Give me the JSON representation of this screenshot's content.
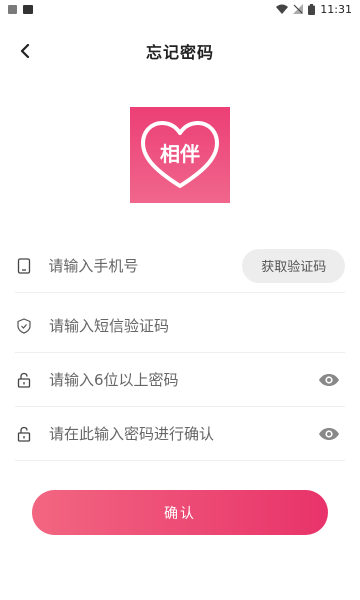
{
  "status_bar": {
    "time": "11:31"
  },
  "header": {
    "title": "忘记密码"
  },
  "logo": {
    "text": "相伴"
  },
  "form": {
    "phone_placeholder": "请输入手机号",
    "get_code_label": "获取验证码",
    "sms_code_placeholder": "请输入短信验证码",
    "password_placeholder": "请输入6位以上密码",
    "confirm_password_placeholder": "请在此输入密码进行确认"
  },
  "confirm_button": {
    "label": "确认"
  },
  "colors": {
    "accent": "#E8336A",
    "accent_light": "#F26681"
  }
}
